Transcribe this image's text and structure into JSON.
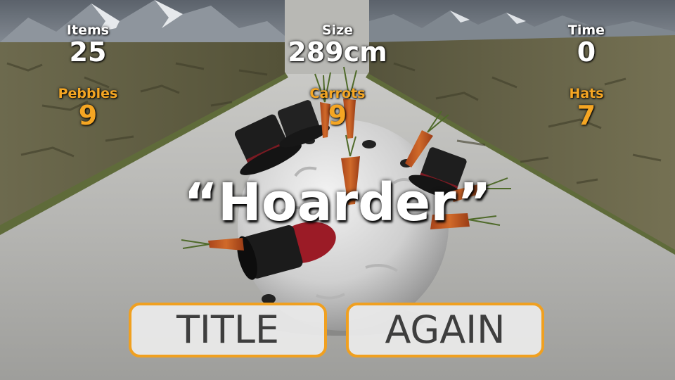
{
  "hud": {
    "items": {
      "label": "Items",
      "value": "25"
    },
    "size": {
      "label": "Size",
      "value": "289cm"
    },
    "time": {
      "label": "Time",
      "value": "0"
    },
    "pebbles": {
      "label": "Pebbles",
      "value": "9"
    },
    "carrots": {
      "label": "Carrots",
      "value": "9"
    },
    "hats": {
      "label": "Hats",
      "value": "7"
    }
  },
  "award_title": "“Hoarder”",
  "buttons": {
    "title": "TITLE",
    "again": "AGAIN"
  },
  "colors": {
    "accent": "#f5a623",
    "button_border": "#f0a020",
    "button_text": "#3e3e3e",
    "hud_text": "#ffffff"
  },
  "icons": [
    "snowball",
    "carrot",
    "top-hat",
    "pebble"
  ]
}
